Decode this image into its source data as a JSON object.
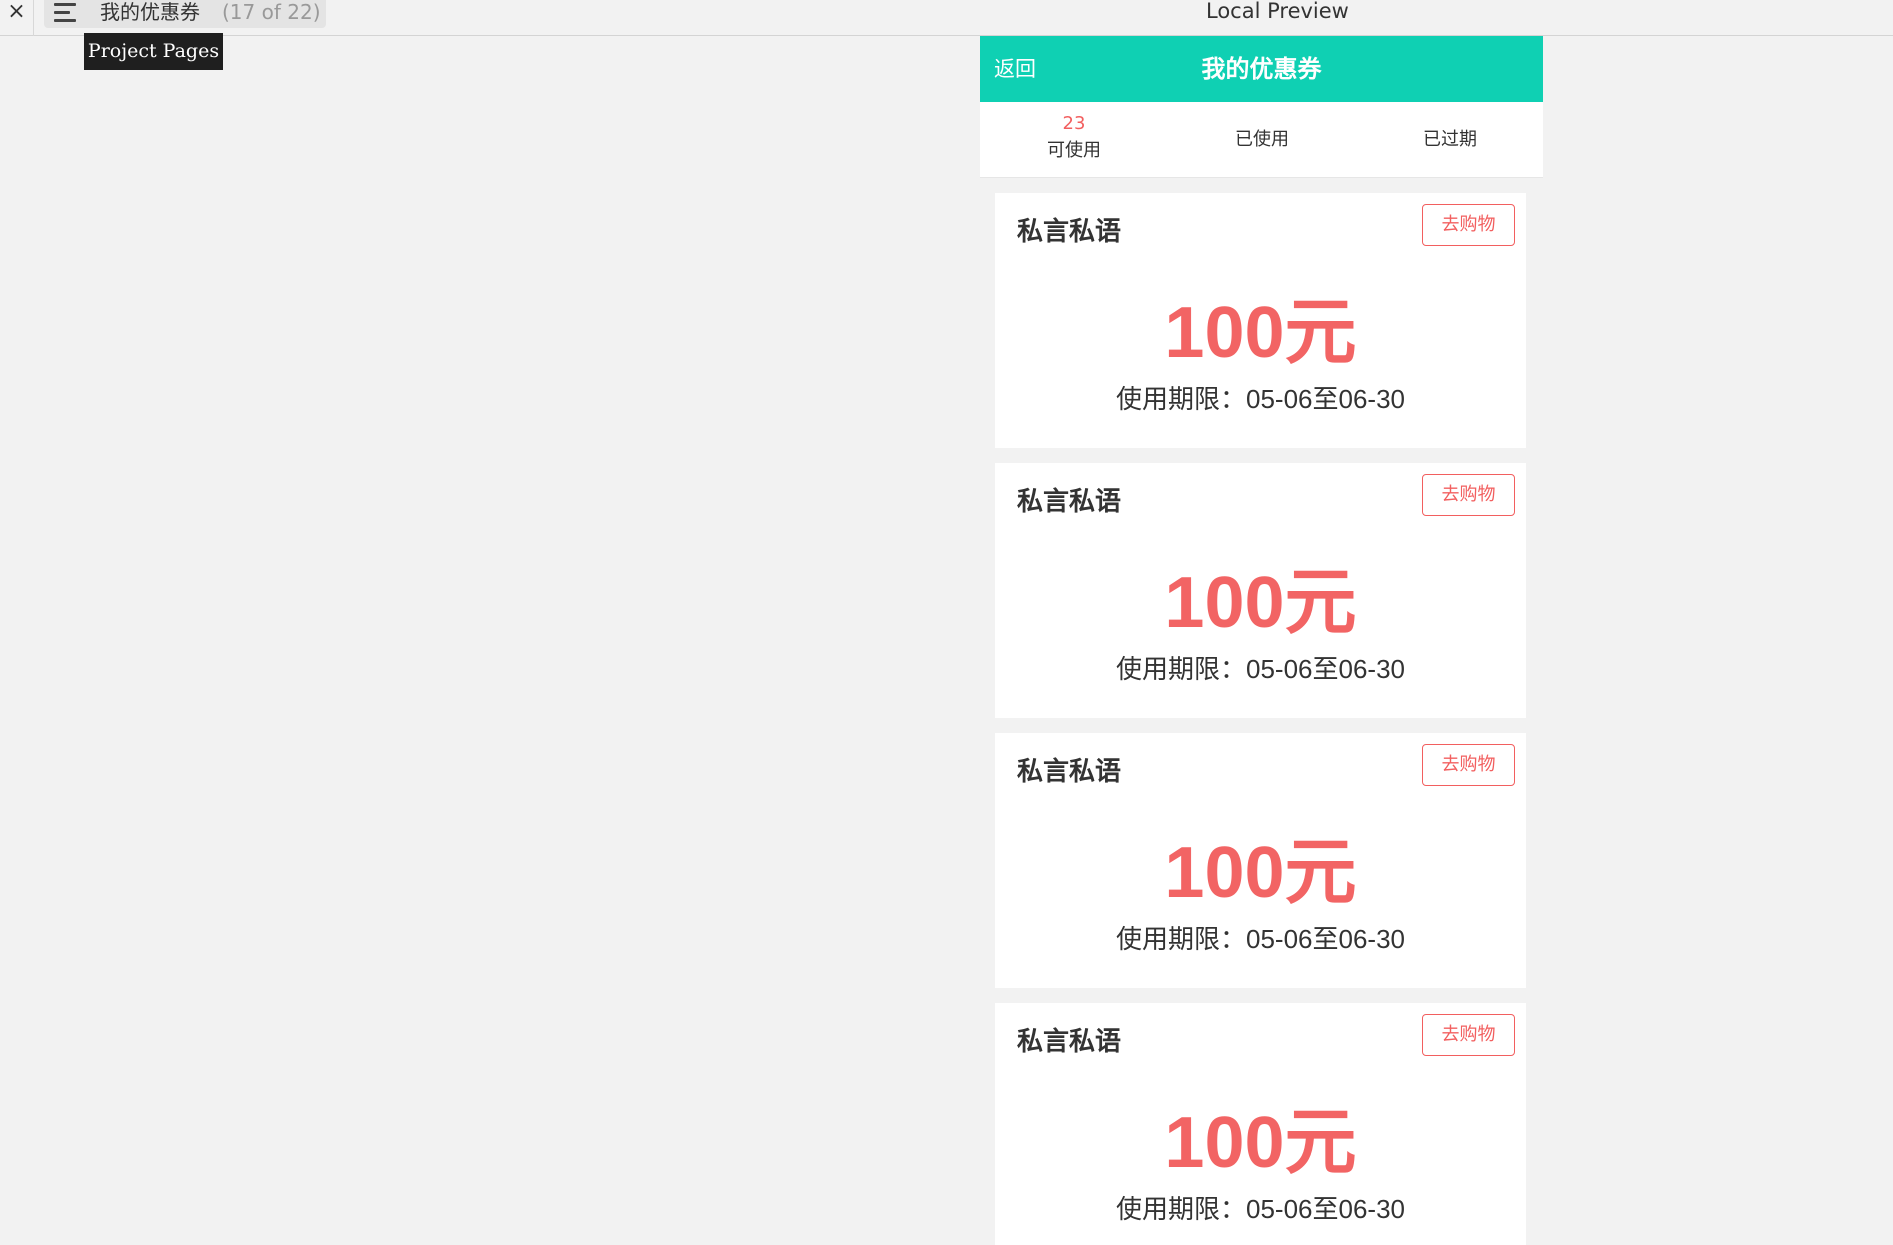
{
  "toolbar": {
    "close_icon": "×",
    "page_name": "我的优惠券",
    "page_count": "(17 of 22)",
    "preview_title": "Local Preview",
    "tooltip": "Project Pages"
  },
  "header": {
    "back_label": "返回",
    "title": "我的优惠券",
    "color": "#0fd0b3"
  },
  "tabs": [
    {
      "count": "23",
      "label": "可使用"
    },
    {
      "label": "已使用"
    },
    {
      "label": "已过期"
    }
  ],
  "coupons": [
    {
      "name": "私言私语",
      "button_label": "去购物",
      "amount": "100元",
      "validity": "使用期限：05-06至06-30"
    },
    {
      "name": "私言私语",
      "button_label": "去购物",
      "amount": "100元",
      "validity": "使用期限：05-06至06-30"
    },
    {
      "name": "私言私语",
      "button_label": "去购物",
      "amount": "100元",
      "validity": "使用期限：05-06至06-30"
    },
    {
      "name": "私言私语",
      "button_label": "去购物",
      "amount": "100元",
      "validity": "使用期限：05-06至06-30"
    }
  ],
  "colors": {
    "accent": "#0fd0b3",
    "highlight": "#f26464",
    "background": "#f2f2f2"
  }
}
